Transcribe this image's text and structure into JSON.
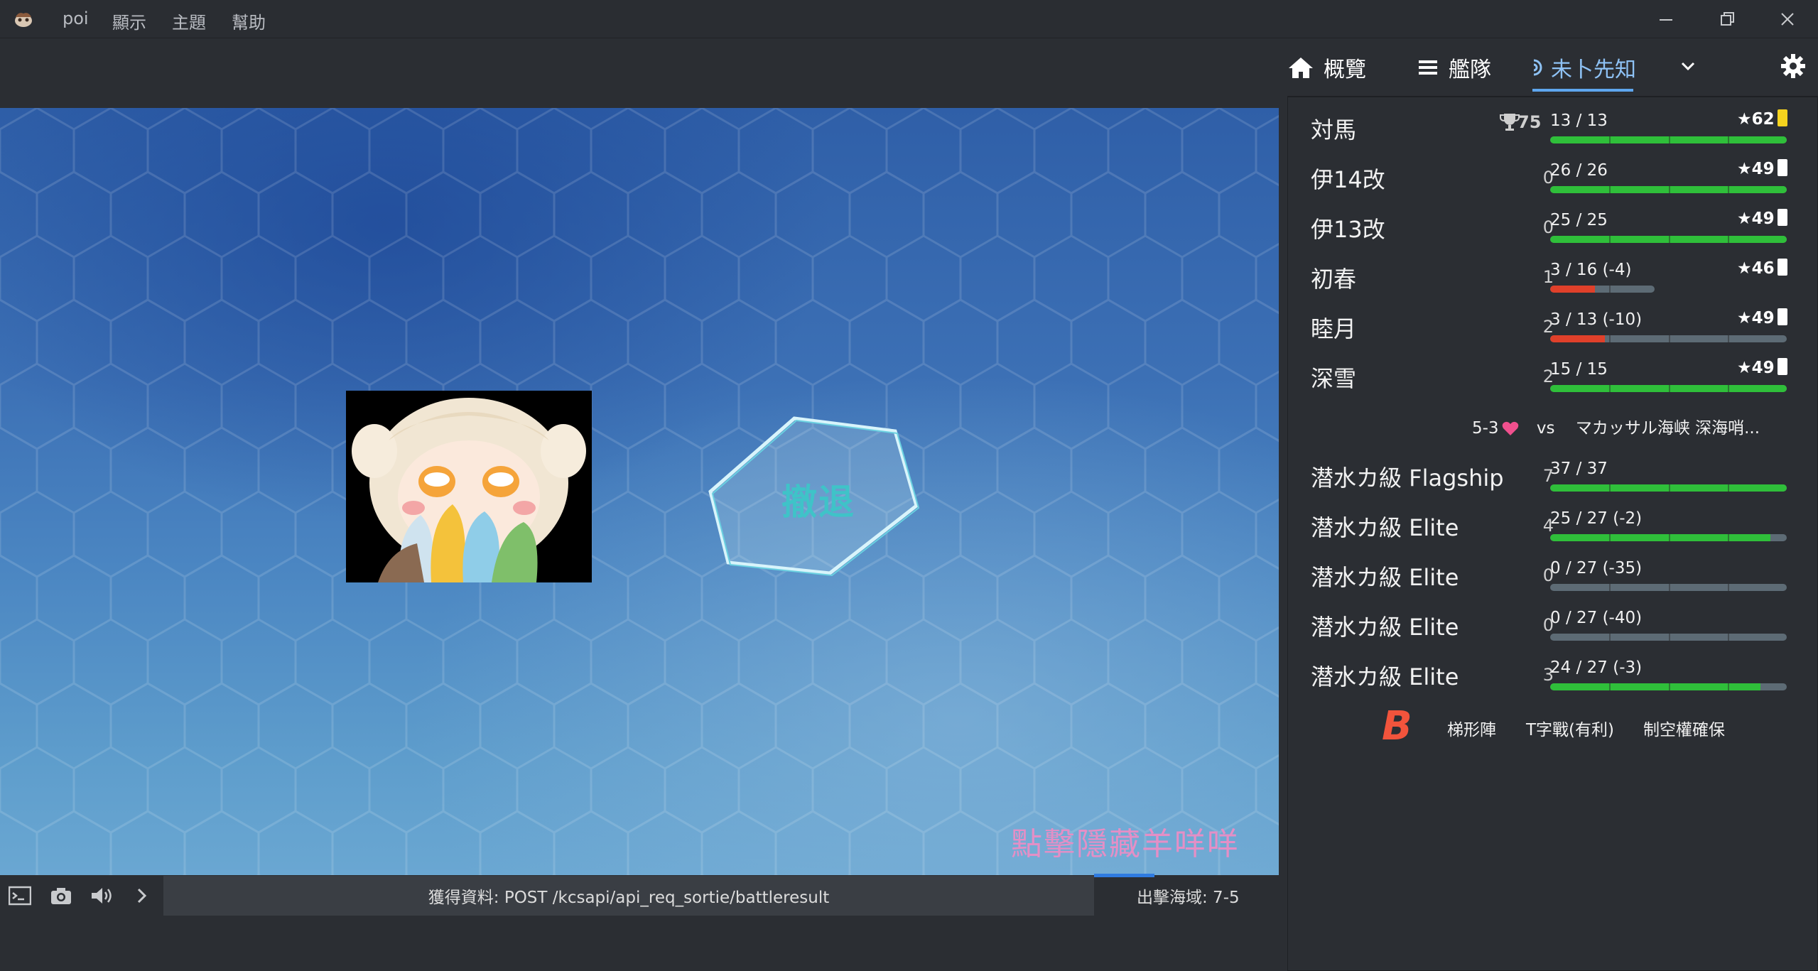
{
  "titlebar": {
    "menu": [
      "poi",
      "顯示",
      "主題",
      "幫助"
    ]
  },
  "game": {
    "retreat_label": "撤退",
    "hide_hint": "點擊隱藏羊咩咩"
  },
  "statusbar": {
    "log": "獲得資料: POST /kcsapi/api_req_sortie/battleresult",
    "sortie_area": "出擊海域: 7-5"
  },
  "nav": {
    "overview": "概覽",
    "fleet": "艦隊",
    "battle": "未卜先知"
  },
  "battle": {
    "mvp_score": "75",
    "friendly": [
      {
        "name": "対馬",
        "lv": "",
        "hp": "13 / 13",
        "hp_ratio": 1.0,
        "hp_color": "#2fbf3a",
        "cond": "★62",
        "fuel_color": "#f5d31e"
      },
      {
        "name": "伊14改",
        "lv": "0",
        "hp": "26 / 26",
        "hp_ratio": 1.0,
        "hp_color": "#2fbf3a",
        "cond": "★49",
        "fuel_color": "#ffffff"
      },
      {
        "name": "伊13改",
        "lv": "0",
        "hp": "25 / 25",
        "hp_ratio": 1.0,
        "hp_color": "#2fbf3a",
        "cond": "★49",
        "fuel_color": "#ffffff"
      },
      {
        "name": "初春",
        "lv": "1",
        "hp": "3 / 16  (-4)",
        "hp_ratio": 0.19,
        "hp_color": "#e0402a",
        "cond": "★46",
        "fuel_color": "#ffffff",
        "track_ratio": 0.44
      },
      {
        "name": "睦月",
        "lv": "2",
        "hp": "3 / 13  (-10)",
        "hp_ratio": 0.23,
        "hp_color": "#e0402a",
        "cond": "★49",
        "fuel_color": "#ffffff"
      },
      {
        "name": "深雪",
        "lv": "2",
        "hp": "15 / 15",
        "hp_ratio": 1.0,
        "hp_color": "#2fbf3a",
        "cond": "★49",
        "fuel_color": "#ffffff"
      }
    ],
    "enemy_info": {
      "map": "5-3",
      "vs": "vs",
      "name": "マカッサル海峡 深海哨..."
    },
    "enemy": [
      {
        "name": "潜水カ級 Flagship",
        "lv": "7",
        "hp": "37 / 37",
        "hp_ratio": 1.0,
        "hp_color": "#2fbf3a"
      },
      {
        "name": "潜水カ級 Elite",
        "lv": "4",
        "hp": "25 / 27  (-2)",
        "hp_ratio": 0.93,
        "hp_color": "#2fbf3a"
      },
      {
        "name": "潜水カ級 Elite",
        "lv": "0",
        "hp": "0 / 27  (-35)",
        "hp_ratio": 0.0,
        "hp_color": "#2fbf3a"
      },
      {
        "name": "潜水カ級 Elite",
        "lv": "0",
        "hp": "0 / 27  (-40)",
        "hp_ratio": 0.0,
        "hp_color": "#2fbf3a"
      },
      {
        "name": "潜水カ級 Elite",
        "lv": "3",
        "hp": "24 / 27  (-3)",
        "hp_ratio": 0.89,
        "hp_color": "#2fbf3a"
      }
    ],
    "result": {
      "rank": "B",
      "formation": "梯形陣",
      "engagement": "T字戰(有利)",
      "air": "制空權確保"
    }
  }
}
